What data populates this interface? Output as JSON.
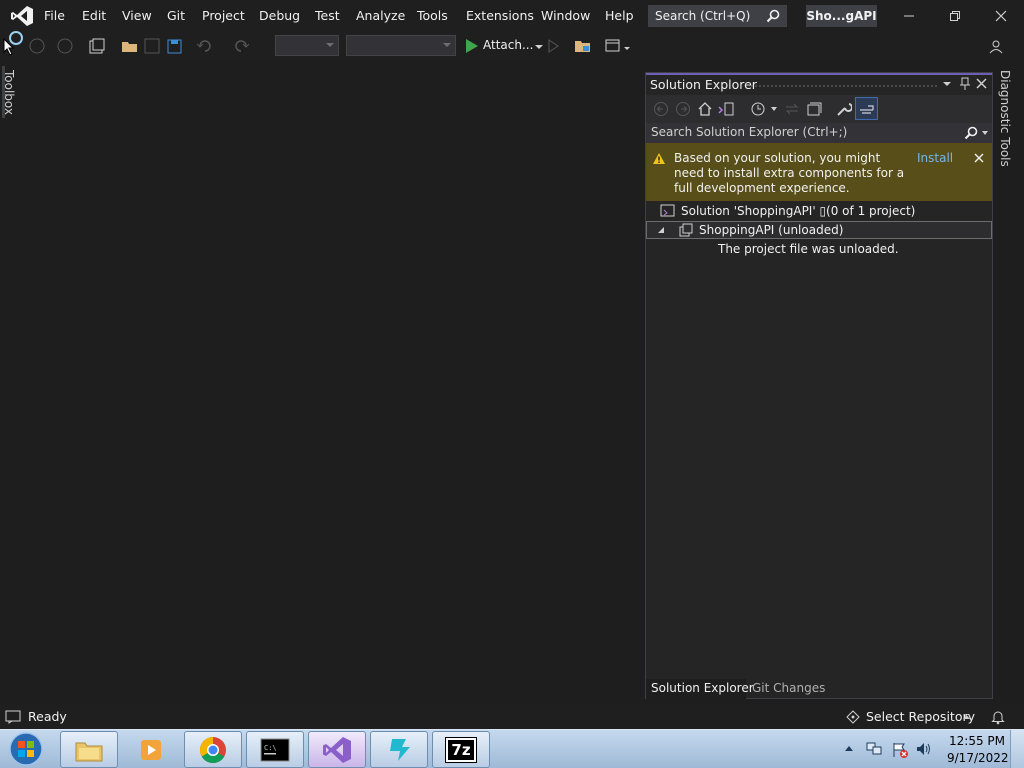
{
  "menu": {
    "items": [
      "File",
      "Edit",
      "View",
      "Git",
      "Project",
      "Debug",
      "Test",
      "Analyze",
      "Tools",
      "Extensions",
      "Window",
      "Help"
    ]
  },
  "search": {
    "label": "Search (Ctrl+Q)"
  },
  "solution_badge": "Sho...gAPI",
  "toolbar": {
    "attach_label": "Attach..."
  },
  "toolbox": {
    "label": "Toolbox"
  },
  "diagnostic": {
    "label": "Diagnostic Tools"
  },
  "solution_explorer": {
    "title": "Solution Explorer",
    "search_placeholder": "Search Solution Explorer (Ctrl+;)",
    "info_message": "Based on your solution, you might need to install extra components for a full development experience.",
    "info_action": "Install",
    "tree": {
      "solution": "Solution 'ShoppingAPI' ▯(0 of 1 project)",
      "project": "ShoppingAPI (unloaded)",
      "project_note": "The project file was unloaded."
    },
    "tabs": [
      "Solution Explorer",
      "Git Changes"
    ]
  },
  "statusbar": {
    "status": "Ready",
    "repo": "Select Repository"
  },
  "taskbar": {
    "time": "12:55 PM",
    "date": "9/17/2022",
    "sevenzip_label": "7z"
  },
  "colors": {
    "accent": "#6c5fb5",
    "infobar": "#574e19",
    "link": "#75b6e7"
  }
}
